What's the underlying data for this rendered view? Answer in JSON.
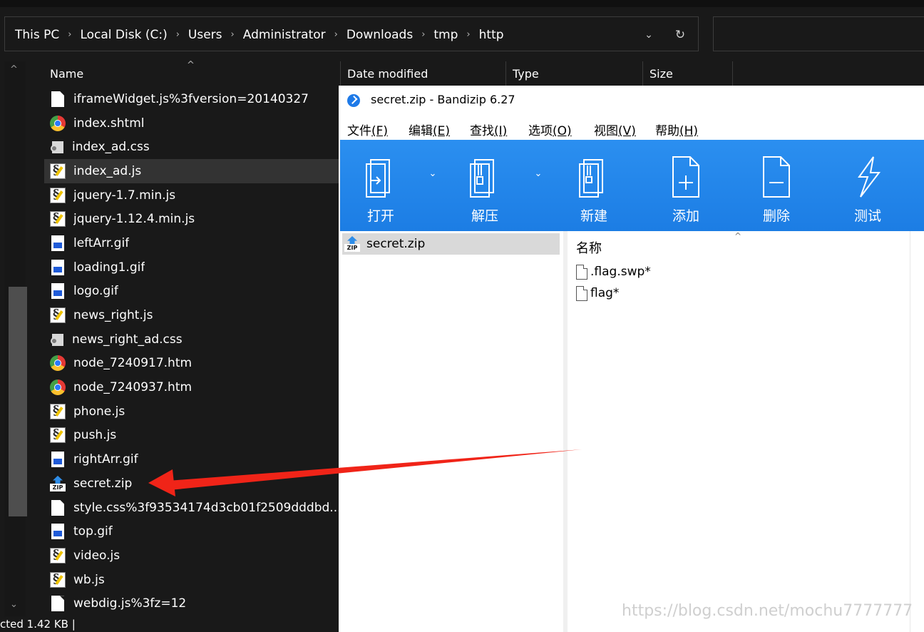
{
  "explorer": {
    "breadcrumb": [
      "This PC",
      "Local Disk (C:)",
      "Users",
      "Administrator",
      "Downloads",
      "tmp",
      "http"
    ],
    "breadcrumb_separator": "›",
    "dropdown_glyph": "⌄",
    "refresh_glyph": "↻",
    "columns": {
      "name": "Name",
      "date_modified": "Date modified",
      "type": "Type",
      "size": "Size"
    },
    "files": [
      {
        "name": "iframeWidget.js%3fversion=20140327",
        "icon": "document-icon"
      },
      {
        "name": "index.shtml",
        "icon": "chrome-icon"
      },
      {
        "name": "index_ad.css",
        "icon": "css-file-icon"
      },
      {
        "name": "index_ad.js",
        "icon": "js-file-icon",
        "selected": true
      },
      {
        "name": "jquery-1.7.min.js",
        "icon": "js-file-icon"
      },
      {
        "name": "jquery-1.12.4.min.js",
        "icon": "js-file-icon"
      },
      {
        "name": "leftArr.gif",
        "icon": "image-file-icon"
      },
      {
        "name": "loading1.gif",
        "icon": "image-file-icon"
      },
      {
        "name": "logo.gif",
        "icon": "image-file-icon"
      },
      {
        "name": "news_right.js",
        "icon": "js-file-icon"
      },
      {
        "name": "news_right_ad.css",
        "icon": "css-file-icon"
      },
      {
        "name": "node_7240917.htm",
        "icon": "chrome-icon"
      },
      {
        "name": "node_7240937.htm",
        "icon": "chrome-icon"
      },
      {
        "name": "phone.js",
        "icon": "js-file-icon"
      },
      {
        "name": "push.js",
        "icon": "js-file-icon"
      },
      {
        "name": "rightArr.gif",
        "icon": "image-file-icon"
      },
      {
        "name": "secret.zip",
        "icon": "zip-icon"
      },
      {
        "name": "style.css%3f93534174d3cb01f2509dddbd...",
        "icon": "document-icon"
      },
      {
        "name": "top.gif",
        "icon": "image-file-icon"
      },
      {
        "name": "video.js",
        "icon": "js-file-icon"
      },
      {
        "name": "wb.js",
        "icon": "js-file-icon"
      },
      {
        "name": "webdig.js%3fz=12",
        "icon": "document-icon"
      }
    ],
    "status": "cted  1.42 KB   |"
  },
  "bandizip": {
    "title": "secret.zip - Bandizip 6.27",
    "menu": [
      {
        "label": "文件",
        "key": "(F)"
      },
      {
        "label": "编辑",
        "key": "(E)"
      },
      {
        "label": "查找",
        "key": "(I)"
      },
      {
        "label": "选项",
        "key": "(O)"
      },
      {
        "label": "视图",
        "key": "(V)"
      },
      {
        "label": "帮助",
        "key": "(H)"
      }
    ],
    "toolbar": [
      {
        "label": "打开",
        "icon": "open-icon",
        "dropdown": true
      },
      {
        "label": "解压",
        "icon": "extract-icon",
        "dropdown": true
      },
      {
        "label": "新建",
        "icon": "new-archive-icon"
      },
      {
        "label": "添加",
        "icon": "add-icon"
      },
      {
        "label": "删除",
        "icon": "delete-icon"
      },
      {
        "label": "测试",
        "icon": "test-icon"
      }
    ],
    "dropdown_glyph": "⌄",
    "tree": {
      "label": "secret.zip"
    },
    "list_header": "名称",
    "entries": [
      ".flag.swp*",
      "flag*"
    ]
  },
  "watermark": "https://blog.csdn.net/mochu7777777",
  "colors": {
    "explorer_bg": "#191919",
    "bandizip_toolbar": "#2086ea",
    "annotation_arrow": "#f02418"
  }
}
